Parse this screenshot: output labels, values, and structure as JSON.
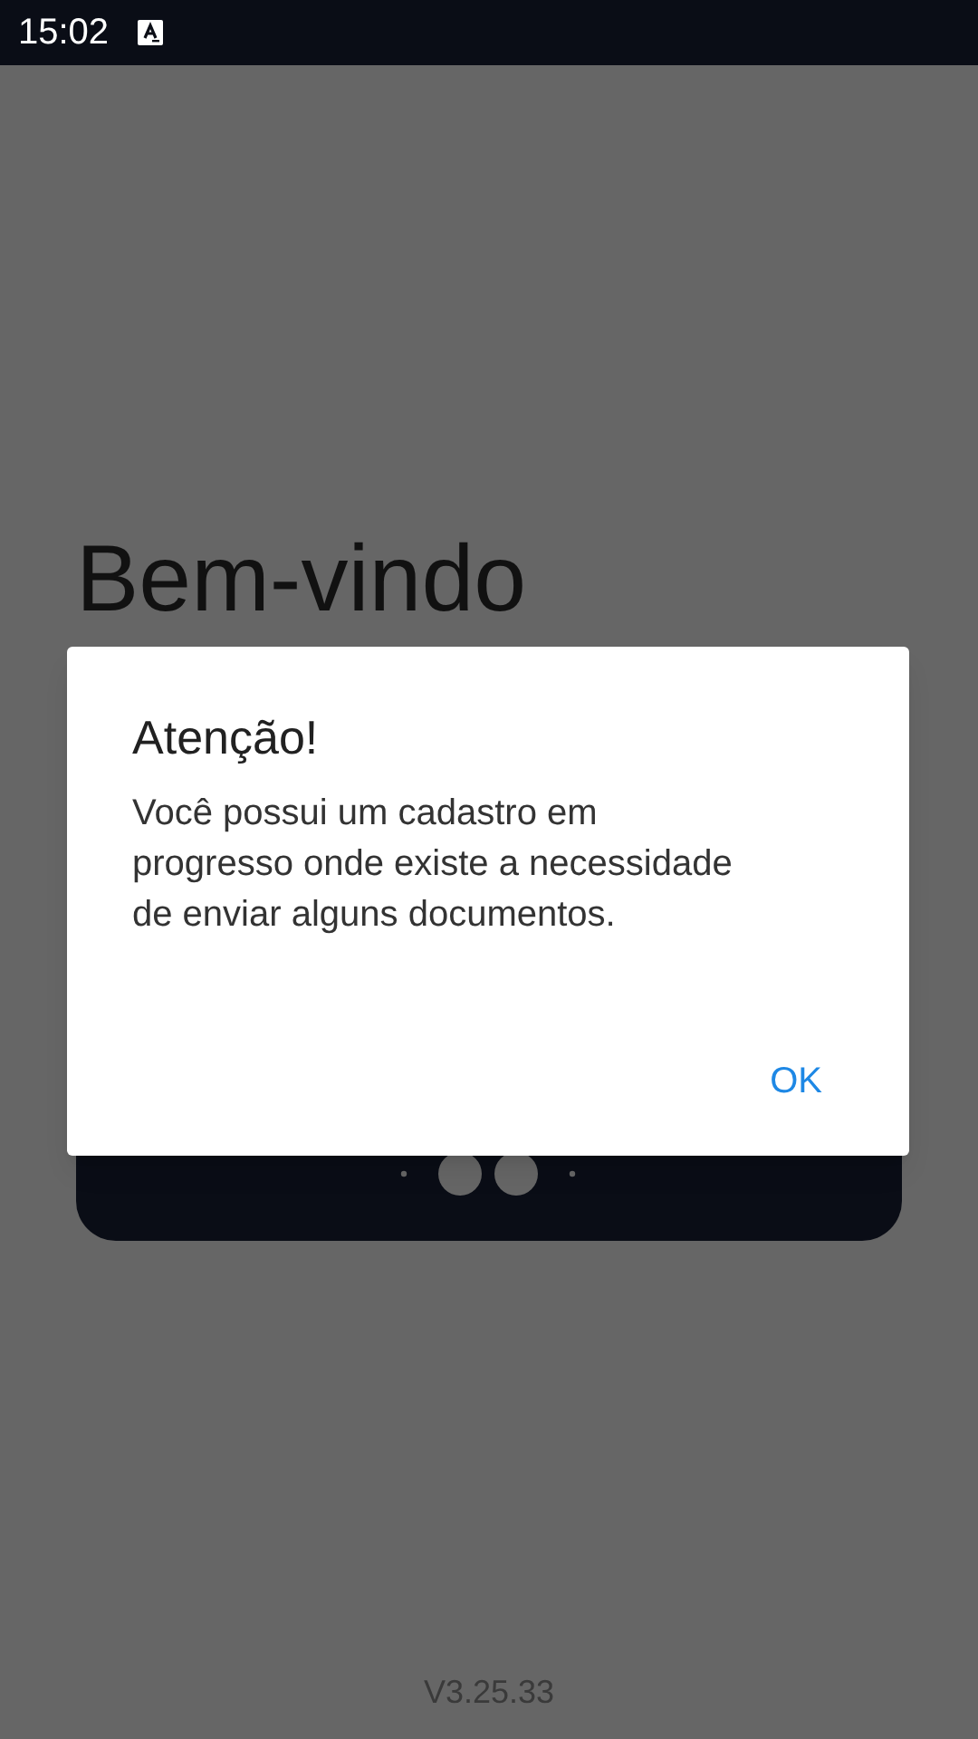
{
  "status_bar": {
    "time": "15:02"
  },
  "screen": {
    "title": "Bem-vindo",
    "version": "V3.25.33"
  },
  "dialog": {
    "title": "Atenção!",
    "message": "Você possui um cadastro em progresso onde existe a necessidade de enviar alguns documentos.",
    "buttons": [
      "OK"
    ]
  }
}
